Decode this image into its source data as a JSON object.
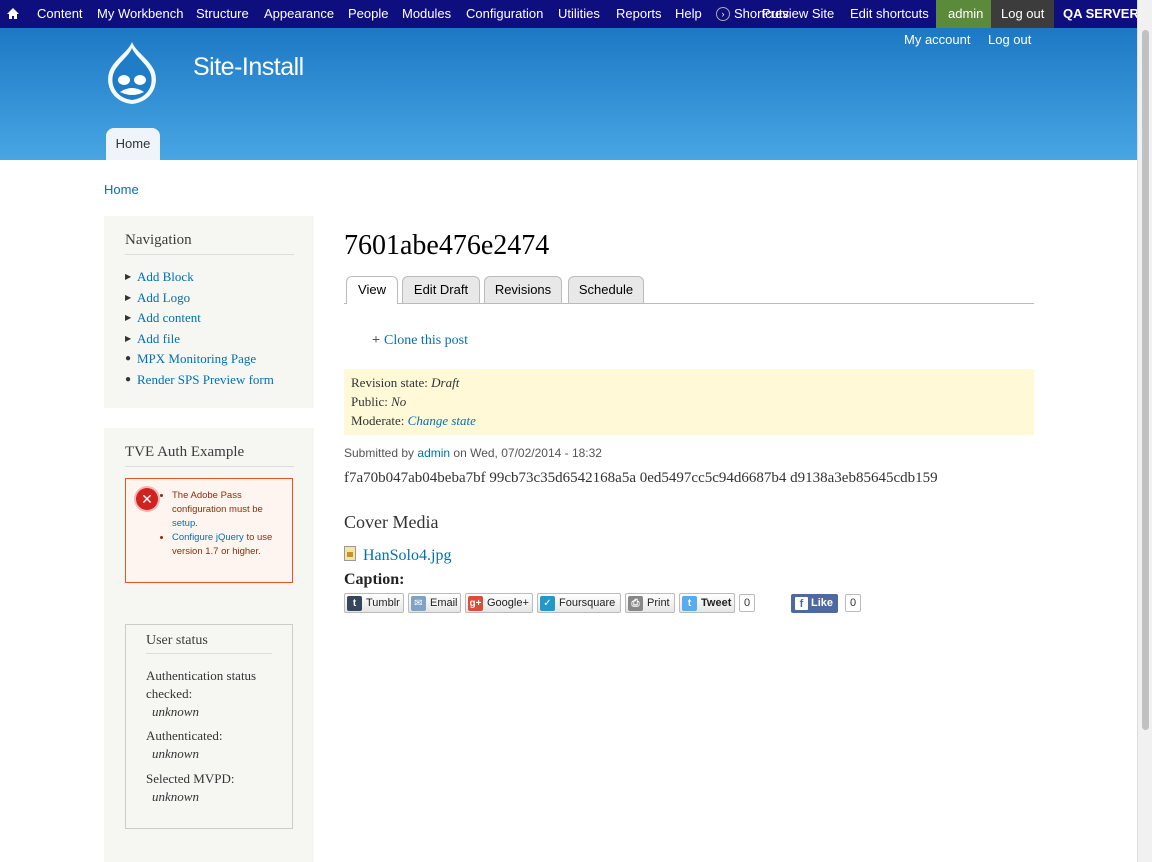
{
  "toolbar": {
    "items": [
      "Content",
      "My Workbench",
      "Structure",
      "Appearance",
      "People",
      "Modules",
      "Configuration",
      "Utilities",
      "Reports",
      "Help"
    ],
    "shortcuts_label": "Shortcuts",
    "preview_site": "Preview Site",
    "edit_shortcuts": "Edit shortcuts",
    "admin": "admin",
    "logout": "Log out",
    "server": "QA SERVER"
  },
  "header": {
    "site_name": "Site-Install",
    "secondary_menu": [
      "My account",
      "Log out"
    ],
    "primary_tab": "Home"
  },
  "breadcrumb": "Home",
  "navigation": {
    "title": "Navigation",
    "items": [
      "Add Block",
      "Add Logo",
      "Add content",
      "Add file",
      "MPX Monitoring Page",
      "Render SPS Preview form"
    ]
  },
  "tve": {
    "title": "TVE Auth Example",
    "error_1_prefix": "The Adobe Pass configuration must be",
    "error_1_link": "setup",
    "error_1_suffix": ".",
    "error_2_link": "Configure jQuery",
    "error_2_suffix": "to use version 1.7 or higher."
  },
  "user_status": {
    "title": "User status",
    "auth_checked_label": "Authentication status checked:",
    "auth_checked_value": "unknown",
    "authenticated_label": "Authenticated:",
    "authenticated_value": "unknown",
    "mvpd_label": "Selected MVPD:",
    "mvpd_value": "unknown"
  },
  "main": {
    "title": "7601abe476e2474",
    "tabs": [
      "View",
      "Edit Draft",
      "Revisions",
      "Schedule"
    ],
    "clone_link": "Clone this post",
    "revision_state_label": "Revision state:",
    "revision_state_value": "Draft",
    "public_label": "Public:",
    "public_value": "No",
    "moderate_label": "Moderate:",
    "moderate_link": "Change state",
    "submitted_prefix": "Submitted by",
    "submitted_user": "admin",
    "submitted_suffix": "on Wed, 07/02/2014 - 18:32",
    "body": "f7a70b047ab04beba7bf 99cb73c35d6542168a5a 0ed5497cc5c94d6687b4 d9138a3eb85645cdb159",
    "cover_media_label": "Cover Media",
    "file_name": "HanSolo4.jpg",
    "caption_label": "Caption:"
  },
  "share": {
    "tumblr": "Tumblr",
    "email": "Email",
    "google": "Google+",
    "foursquare": "Foursquare",
    "print": "Print",
    "tweet": "Tweet",
    "tweet_count": "0",
    "like": "Like",
    "like_count": "0"
  }
}
